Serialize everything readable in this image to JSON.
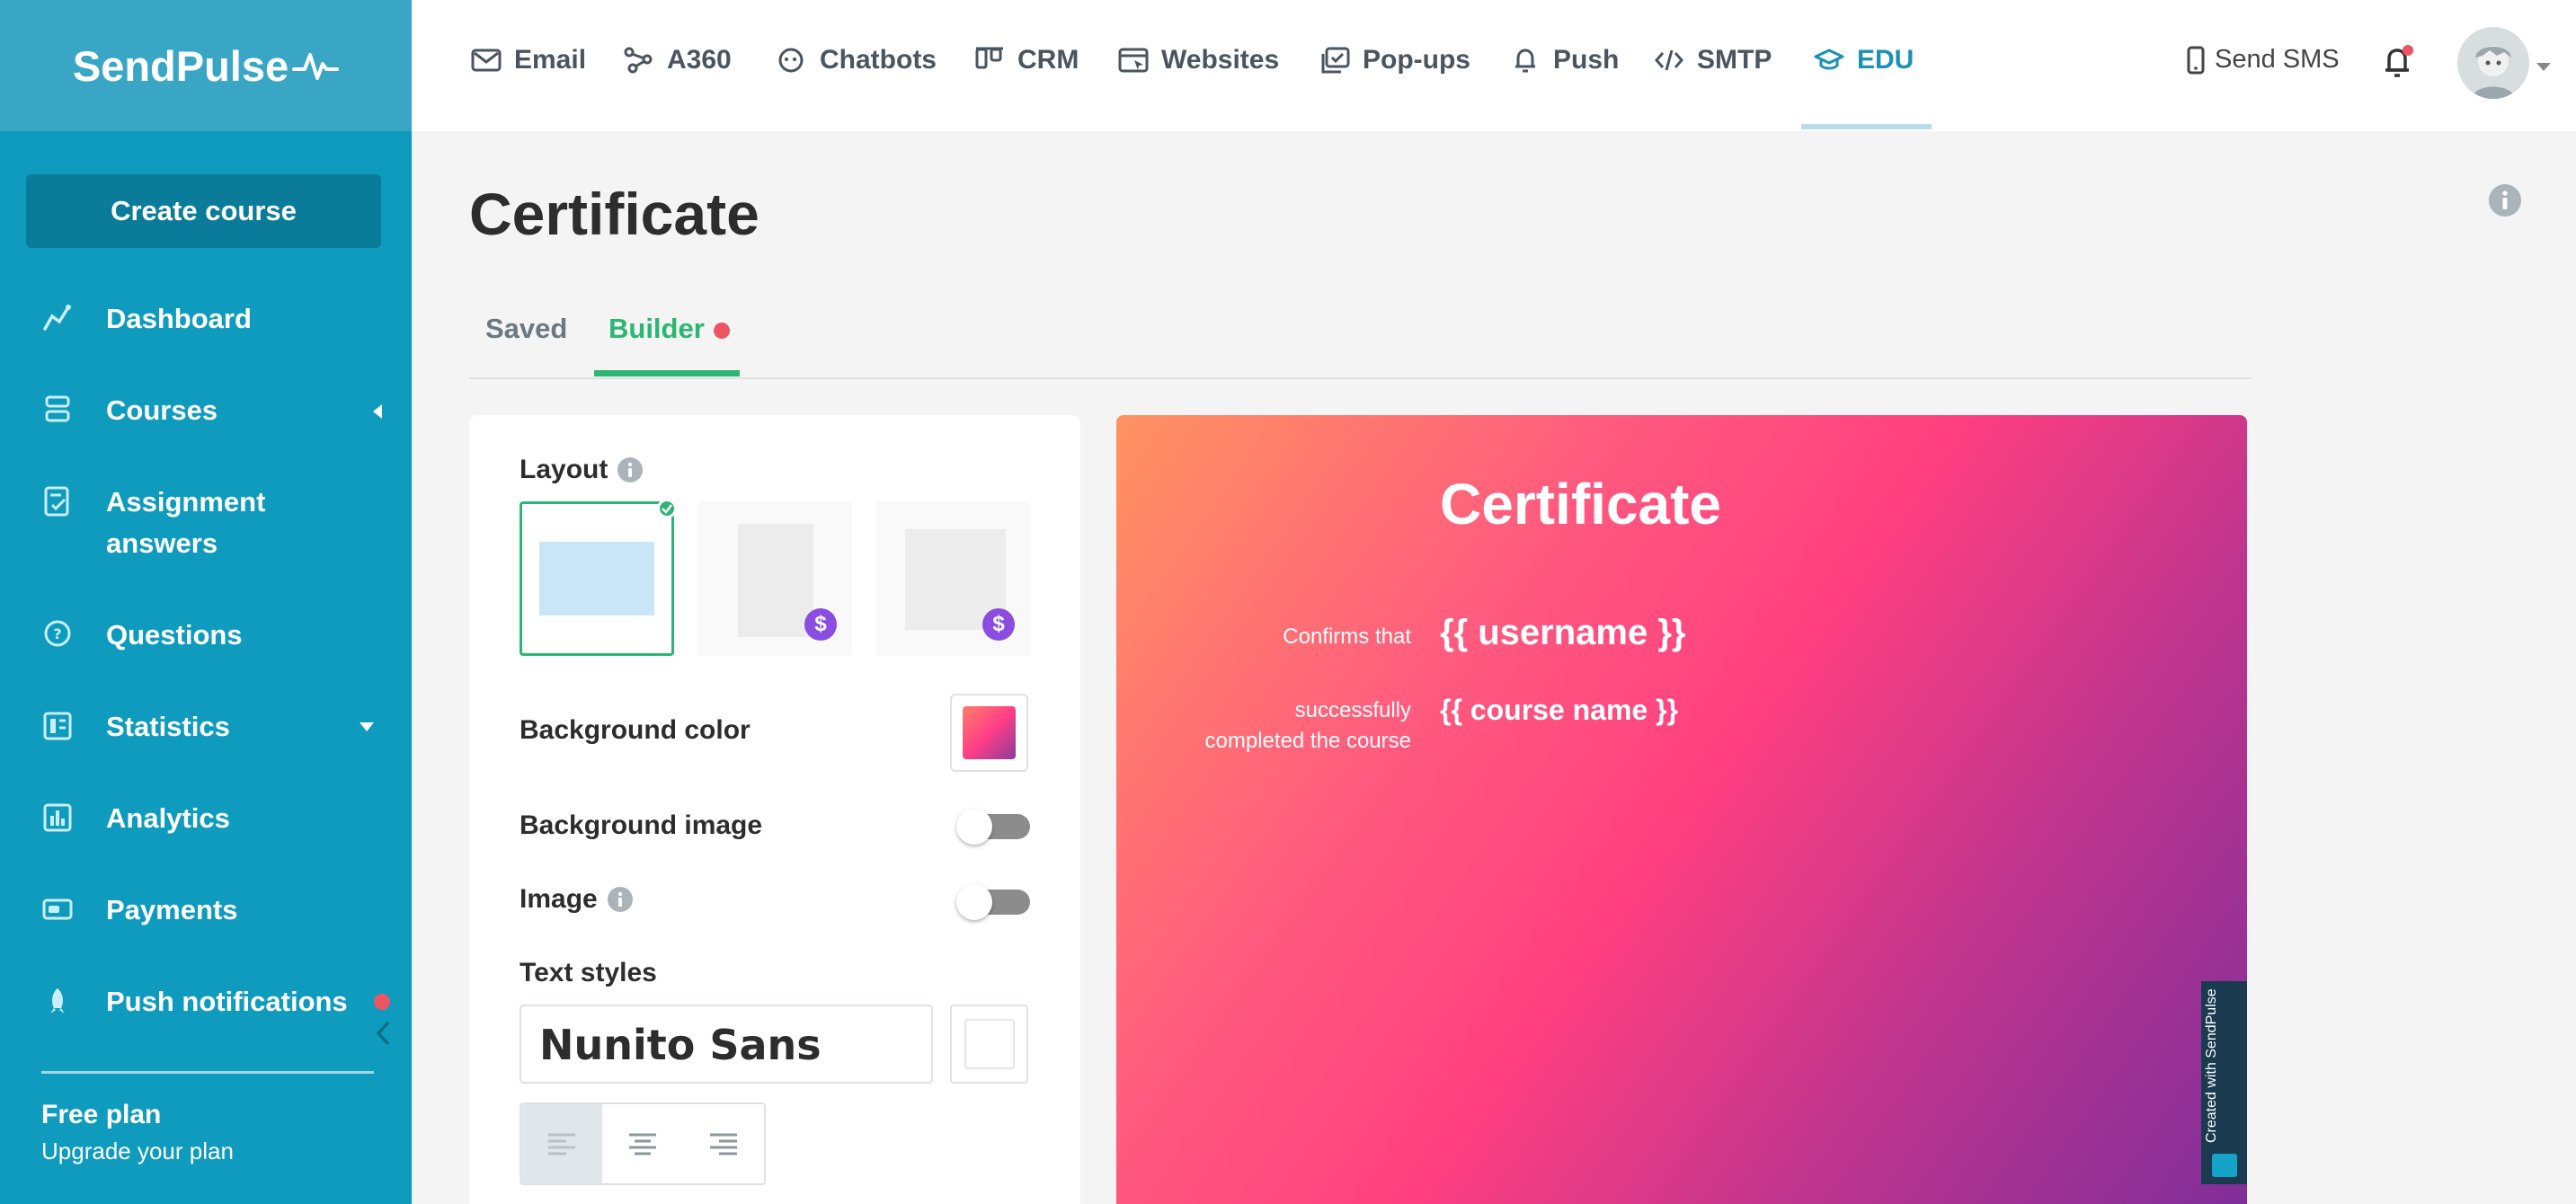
{
  "brand": {
    "name": "SendPulse"
  },
  "sidebar": {
    "create_button": "Create course",
    "items": [
      {
        "label": "Dashboard",
        "icon": "chart-line-icon"
      },
      {
        "label": "Courses",
        "icon": "stack-icon"
      },
      {
        "label": "Assignment answers",
        "icon": "checklist-icon"
      },
      {
        "label": "Questions",
        "icon": "question-bubble-icon"
      },
      {
        "label": "Statistics",
        "icon": "stats-panel-icon"
      },
      {
        "label": "Analytics",
        "icon": "bar-chart-icon"
      },
      {
        "label": "Payments",
        "icon": "wallet-icon"
      },
      {
        "label": "Push notifications",
        "icon": "rocket-icon"
      }
    ],
    "plan_title": "Free plan",
    "plan_link": "Upgrade your plan"
  },
  "topnav": {
    "items": [
      {
        "label": "Email",
        "icon": "envelope-icon"
      },
      {
        "label": "A360",
        "icon": "nodes-icon"
      },
      {
        "label": "Chatbots",
        "icon": "chat-icon"
      },
      {
        "label": "CRM",
        "icon": "kanban-icon"
      },
      {
        "label": "Websites",
        "icon": "window-cursor-icon"
      },
      {
        "label": "Pop-ups",
        "icon": "popup-icon"
      },
      {
        "label": "Push",
        "icon": "bell-icon"
      },
      {
        "label": "SMTP",
        "icon": "code-icon"
      },
      {
        "label": "EDU",
        "icon": "graduation-cap-icon"
      }
    ],
    "active": "EDU",
    "send_sms": "Send SMS"
  },
  "page": {
    "title": "Certificate",
    "tabs": [
      {
        "label": "Saved"
      },
      {
        "label": "Builder"
      }
    ],
    "active_tab": "Builder"
  },
  "builder": {
    "layout_label": "Layout",
    "layout_price_symbol": "$",
    "background_color_label": "Background color",
    "background_image_label": "Background image",
    "image_label": "Image",
    "text_styles_label": "Text styles",
    "font_name": "Nunito Sans",
    "background_image_on": false,
    "image_on": false
  },
  "certificate": {
    "title": "Certificate",
    "confirms_label": "Confirms that",
    "username_placeholder": "{{ username }}",
    "completed_label_1": "successfully",
    "completed_label_2": "completed the course",
    "course_placeholder": "{{ course name }}",
    "badge_text": "Created with SendPulse"
  },
  "colors": {
    "sidebar": "#0f9bbd",
    "accent_green": "#2bb673",
    "notification_red": "#ef5465",
    "active_nav": "#1a92b5"
  }
}
